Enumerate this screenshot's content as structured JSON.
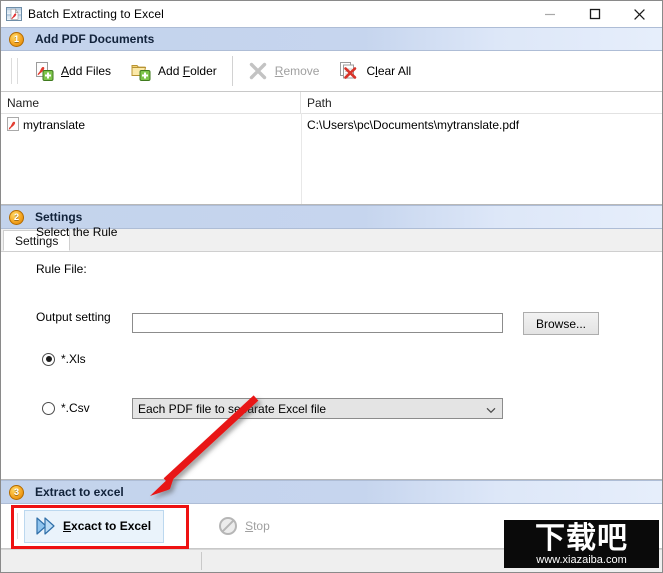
{
  "window": {
    "title": "Batch Extracting to Excel",
    "app_icon": "pdf-to-excel-icon",
    "minimize_label": "—",
    "maximize_label": "□",
    "close_label": "✕"
  },
  "sections": {
    "one": {
      "number": "1",
      "title": "Add PDF Documents"
    },
    "two": {
      "number": "2",
      "title": "Settings"
    },
    "three": {
      "number": "3",
      "title": "Extract to excel"
    }
  },
  "toolbar": {
    "add_files": {
      "label": "Add Files",
      "accel": "A",
      "icon": "pdf-add-icon",
      "enabled": true
    },
    "add_folder": {
      "label": "Add Folder",
      "accel": "F",
      "icon": "folder-add-icon",
      "enabled": true
    },
    "remove": {
      "label": "Remove",
      "accel": "R",
      "icon": "remove-x-icon",
      "enabled": false
    },
    "clear_all": {
      "label": "Clear All",
      "accel": "l",
      "icon": "clear-all-icon",
      "enabled": true
    }
  },
  "filelist": {
    "columns": [
      "Name",
      "Path"
    ],
    "rows": [
      {
        "name": "mytranslate",
        "path": "C:\\Users\\pc\\Documents\\mytranslate.pdf",
        "icon": "pdf-file-icon"
      }
    ]
  },
  "settings": {
    "tab_label": "Settings",
    "rule_group_label": "Select the Rule",
    "rule_file_label": "Rule File:",
    "rule_file_value": "",
    "rule_file_placeholder": "",
    "browse_label": "Browse...",
    "output_group_label": "Output setting",
    "xls": {
      "label": "*.Xls",
      "checked": true
    },
    "csv": {
      "label": "*.Csv",
      "checked": false
    },
    "xls_mode_selected": "Each PDF file to separate Excel file",
    "xls_mode_options": [
      "Each PDF file to separate Excel file"
    ],
    "dropdown_icon": "chevron-down-icon"
  },
  "extract": {
    "run": {
      "label": "Excact to Excel",
      "accel": "E",
      "icon": "fast-forward-icon",
      "enabled": true
    },
    "stop": {
      "label": "Stop",
      "accel": "S",
      "icon": "stop-circle-icon",
      "enabled": false
    }
  },
  "statusbar": {
    "left_text": "",
    "right_text": ""
  },
  "annotation": {
    "arrow_color": "#e81313",
    "highlight_color": "#ee1111"
  },
  "watermark": {
    "cjk": "下载吧",
    "url": "www.xiazaiba.com"
  }
}
